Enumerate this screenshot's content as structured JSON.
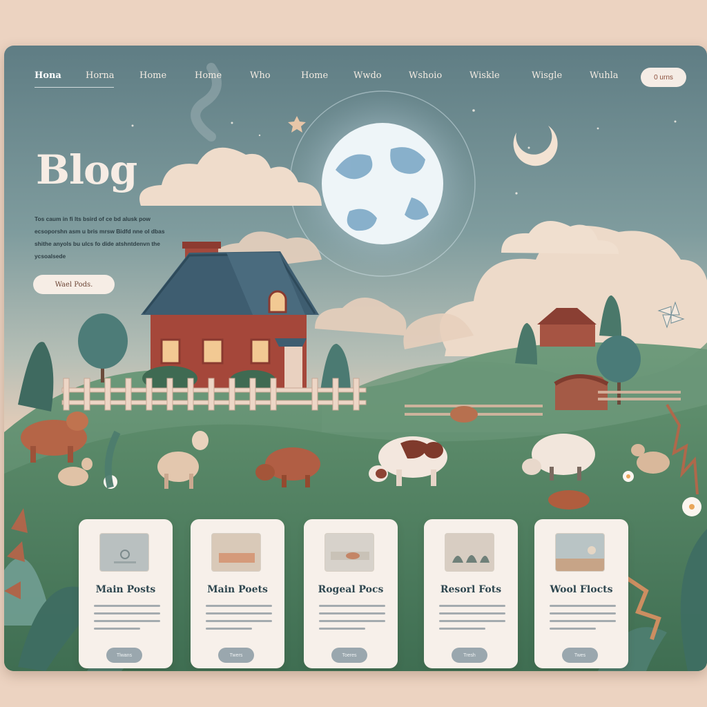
{
  "nav": {
    "items": [
      {
        "label": "Hona",
        "active": true
      },
      {
        "label": "Horna",
        "active": false
      },
      {
        "label": "Home",
        "active": false
      },
      {
        "label": "Home",
        "active": false
      },
      {
        "label": "Who",
        "active": false
      },
      {
        "label": "Home",
        "active": false
      },
      {
        "label": "Wwdo",
        "active": false
      },
      {
        "label": "Wshoio",
        "active": false
      },
      {
        "label": "Wiskle",
        "active": false
      },
      {
        "label": "Wisgle",
        "active": false
      },
      {
        "label": "Wuhla",
        "active": false
      }
    ],
    "cta_label": "0 urns"
  },
  "hero": {
    "title": "Blog",
    "text": "Tos caum in fi lts bsird of ce bd alusk pow ecsoporshn asm u bris mrsw Bidfd nne ol dbas shithe anyols bu ulcs fo dide atshntdenvn the ycsoalsede",
    "button_label": "Wael Pods."
  },
  "cards": [
    {
      "title": "Main Posts",
      "button_label": "Tlwans"
    },
    {
      "title": "Main Poets",
      "button_label": "Twers"
    },
    {
      "title": "Rogeal Pocs",
      "button_label": "Toeres"
    },
    {
      "title": "Resorl Fots",
      "button_label": "Tresh"
    },
    {
      "title": "Wool Flocts",
      "button_label": "Twes"
    }
  ],
  "colors": {
    "sky_top": "#5f7d84",
    "hill_green": "#5e8a6a",
    "barn_red": "#a3473a",
    "card_bg": "#f7f0ea",
    "moon": "#9ec3d9"
  }
}
